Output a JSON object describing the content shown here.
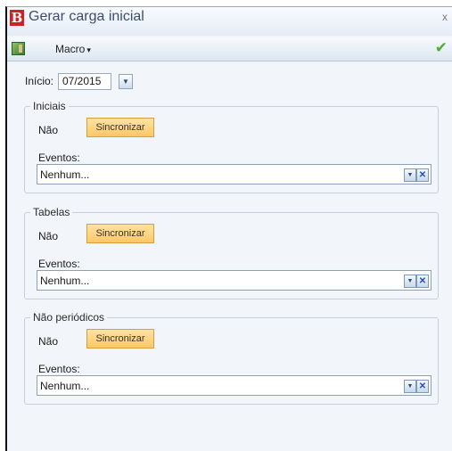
{
  "window": {
    "title": "Gerar carga inicial",
    "close_label": "x",
    "logo_letter": "B"
  },
  "toolbar": {
    "app_icon": "door-exit-icon",
    "macro_label": "Macro",
    "macro_caret": "▾",
    "confirm_icon": "checkmark-icon",
    "confirm_glyph": "✔"
  },
  "inicio": {
    "label": "Início:",
    "value": "07/2015",
    "dropdown_glyph": "▼"
  },
  "groups": [
    {
      "legend": "Iniciais",
      "status": "Não",
      "button": "Sincronizar",
      "eventos_label": "Eventos:",
      "eventos_value": "Nenhum..."
    },
    {
      "legend": "Tabelas",
      "status": "Não",
      "button": "Sincronizar",
      "eventos_label": "Eventos:",
      "eventos_value": "Nenhum..."
    },
    {
      "legend": "Não periódicos",
      "status": "Não",
      "button": "Sincronizar",
      "eventos_label": "Eventos:",
      "eventos_value": "Nenhum..."
    }
  ],
  "field_buttons": {
    "dropdown_glyph": "▼",
    "clear_glyph": "✕"
  },
  "colors": {
    "accent": "#ffc766",
    "logo": "#d41f1f",
    "confirm": "#4eae3a"
  }
}
